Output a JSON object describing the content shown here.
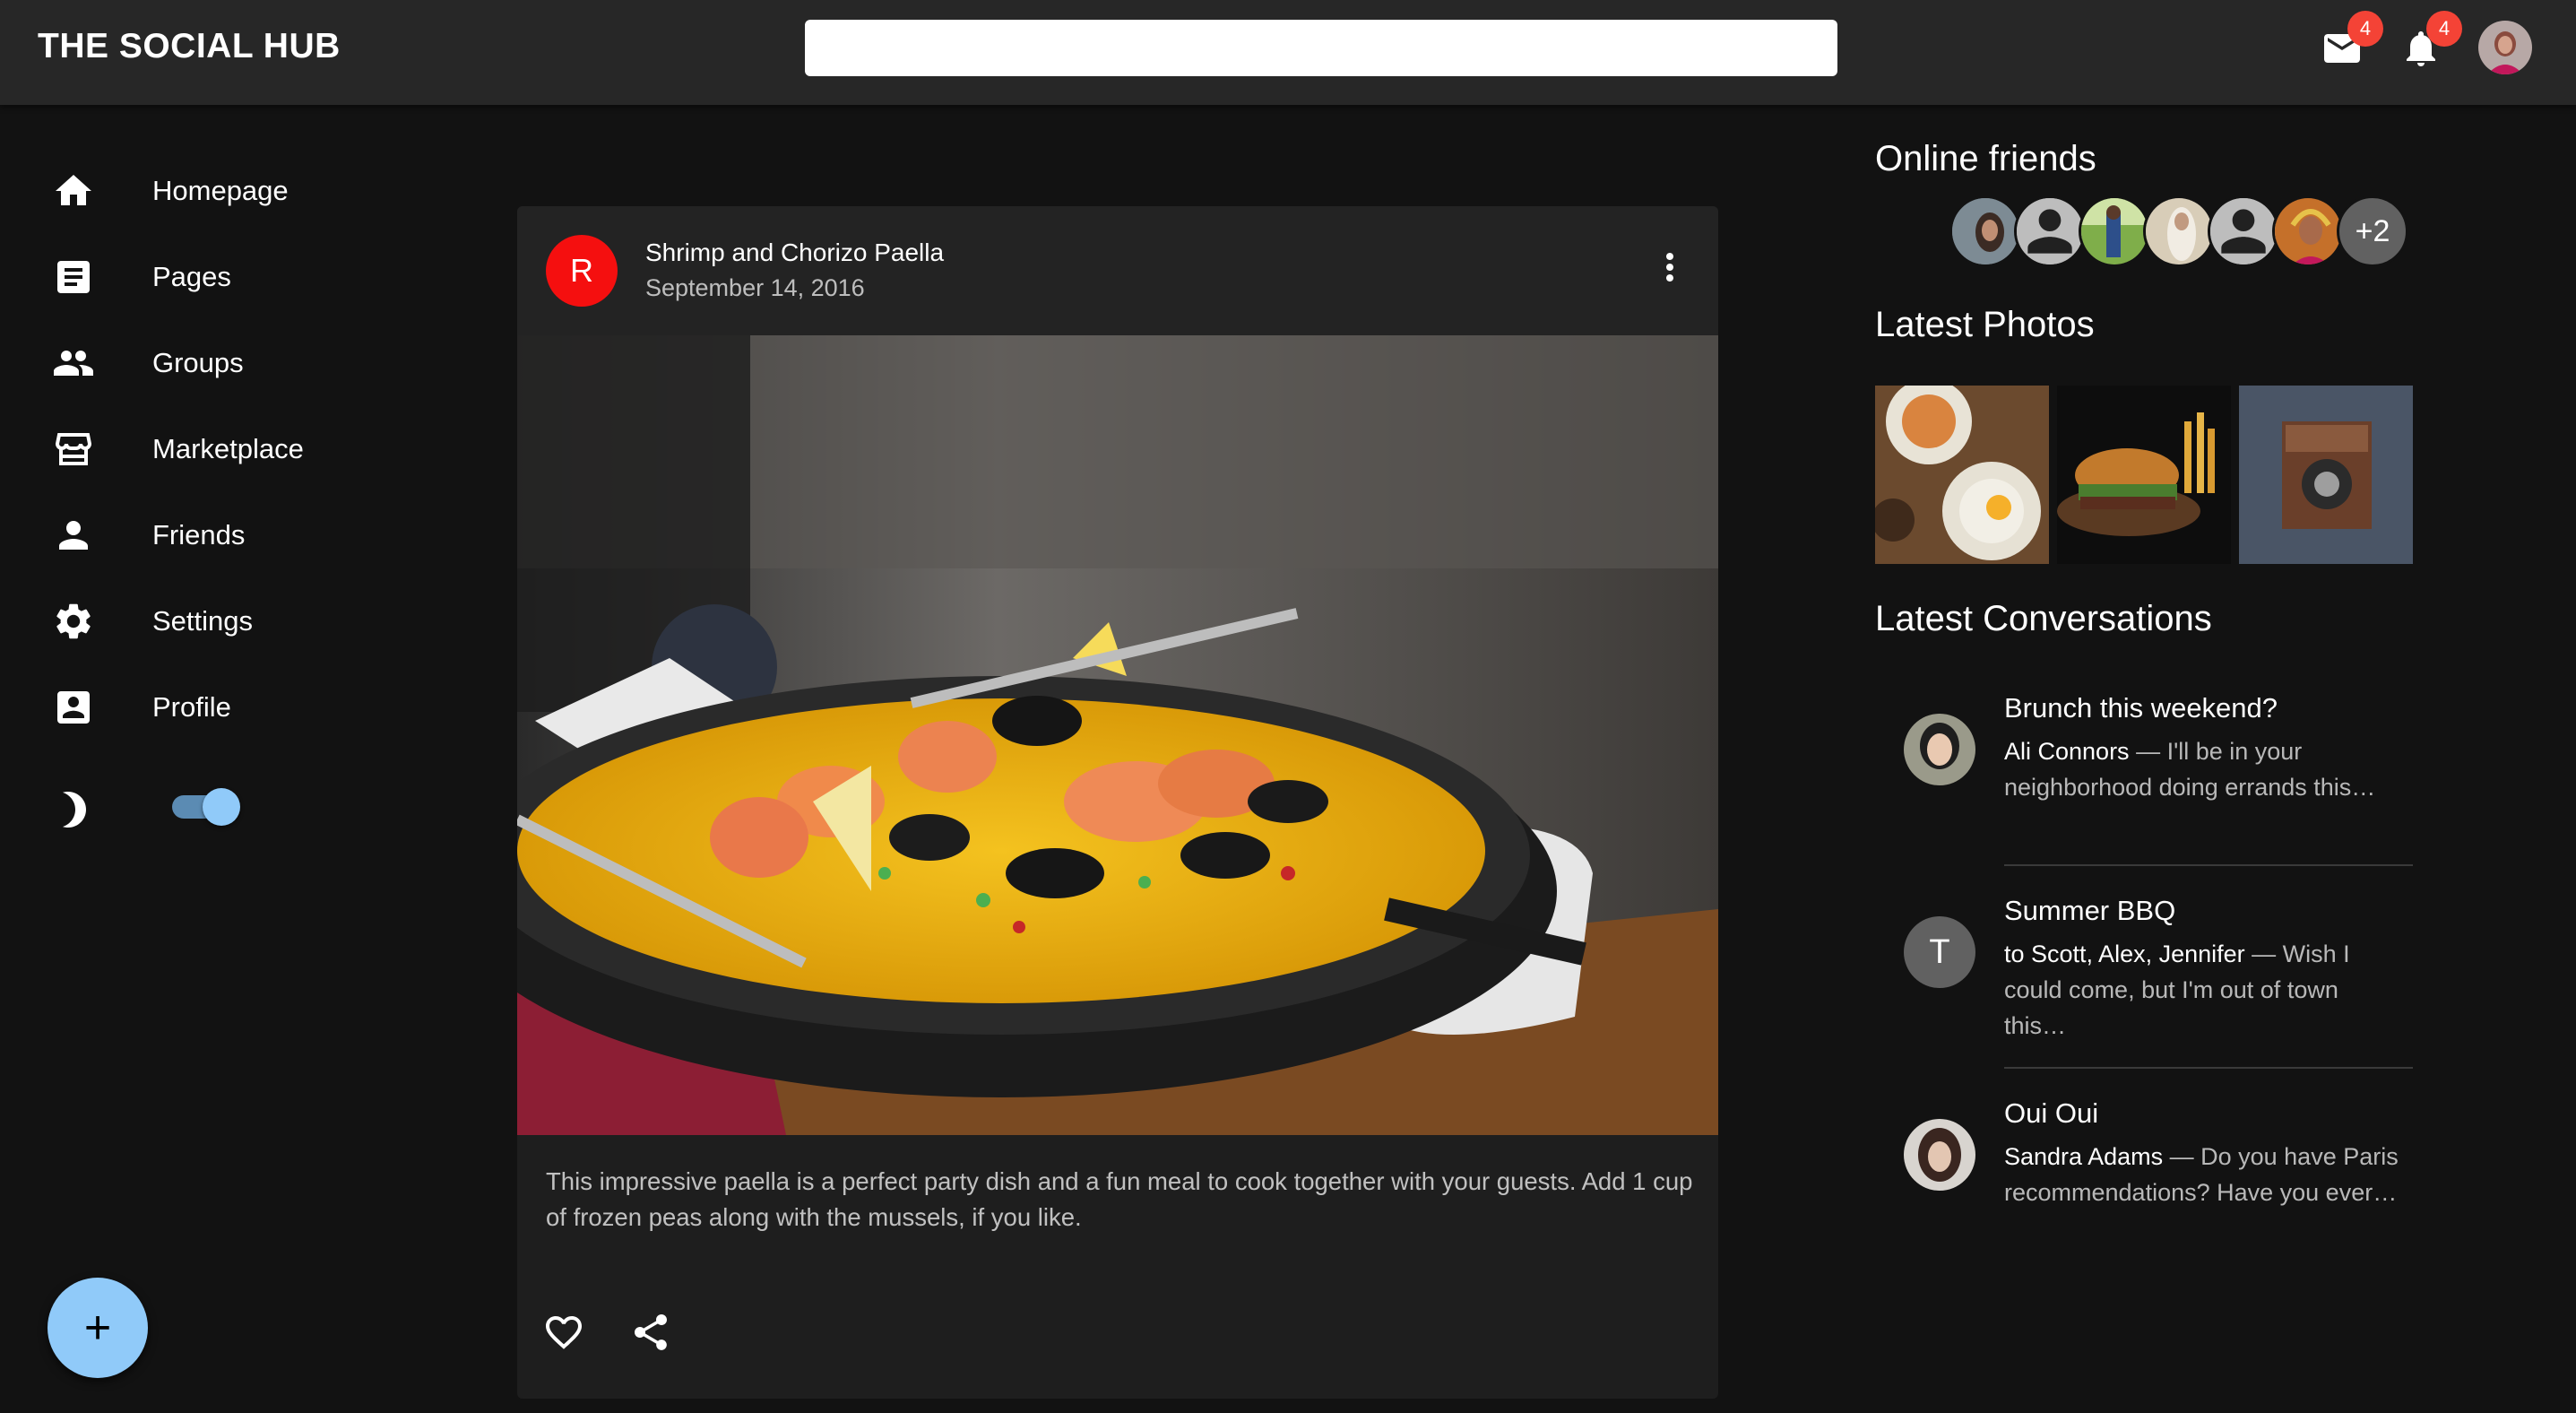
{
  "app": {
    "brand": "THE SOCIAL HUB",
    "search_placeholder": "",
    "mail_count": "4",
    "notifications_count": "4"
  },
  "nav": {
    "items": [
      {
        "label": "Homepage",
        "icon": "home-icon"
      },
      {
        "label": "Pages",
        "icon": "article-icon"
      },
      {
        "label": "Groups",
        "icon": "group-icon"
      },
      {
        "label": "Marketplace",
        "icon": "storefront-icon"
      },
      {
        "label": "Friends",
        "icon": "person-icon"
      },
      {
        "label": "Settings",
        "icon": "gear-icon"
      },
      {
        "label": "Profile",
        "icon": "account-box-icon"
      }
    ],
    "dark_mode_on": true,
    "fab_label": "+"
  },
  "post": {
    "avatar_letter": "R",
    "title": "Shrimp and Chorizo Paella",
    "date": "September 14, 2016",
    "body": "This impressive paella is a perfect party dish and a fun meal to cook together with your guests. Add 1 cup of frozen peas along with the mussels, if you like."
  },
  "sidebar": {
    "online_friends_title": "Online friends",
    "online_friends_more": "+2",
    "latest_photos_title": "Latest Photos",
    "latest_conversations_title": "Latest Conversations",
    "conversations": [
      {
        "title": "Brunch this weekend?",
        "who": "Ali Connors",
        "text": " — I'll be in your neighborhood doing errands this…",
        "avatar_letter": ""
      },
      {
        "title": "Summer BBQ",
        "who": "to Scott, Alex, Jennifer",
        "text": " — Wish I could come, but I'm out of town this…",
        "avatar_letter": "T"
      },
      {
        "title": "Oui Oui",
        "who": "Sandra Adams",
        "text": " — Do you have Paris recommendations? Have you ever…",
        "avatar_letter": ""
      }
    ]
  },
  "colors": {
    "background": "#121212",
    "appbar": "#272727",
    "card": "#1e1e1e",
    "accent": "#90caf9",
    "badge": "#f44336",
    "post_avatar": "#f50f0f"
  }
}
